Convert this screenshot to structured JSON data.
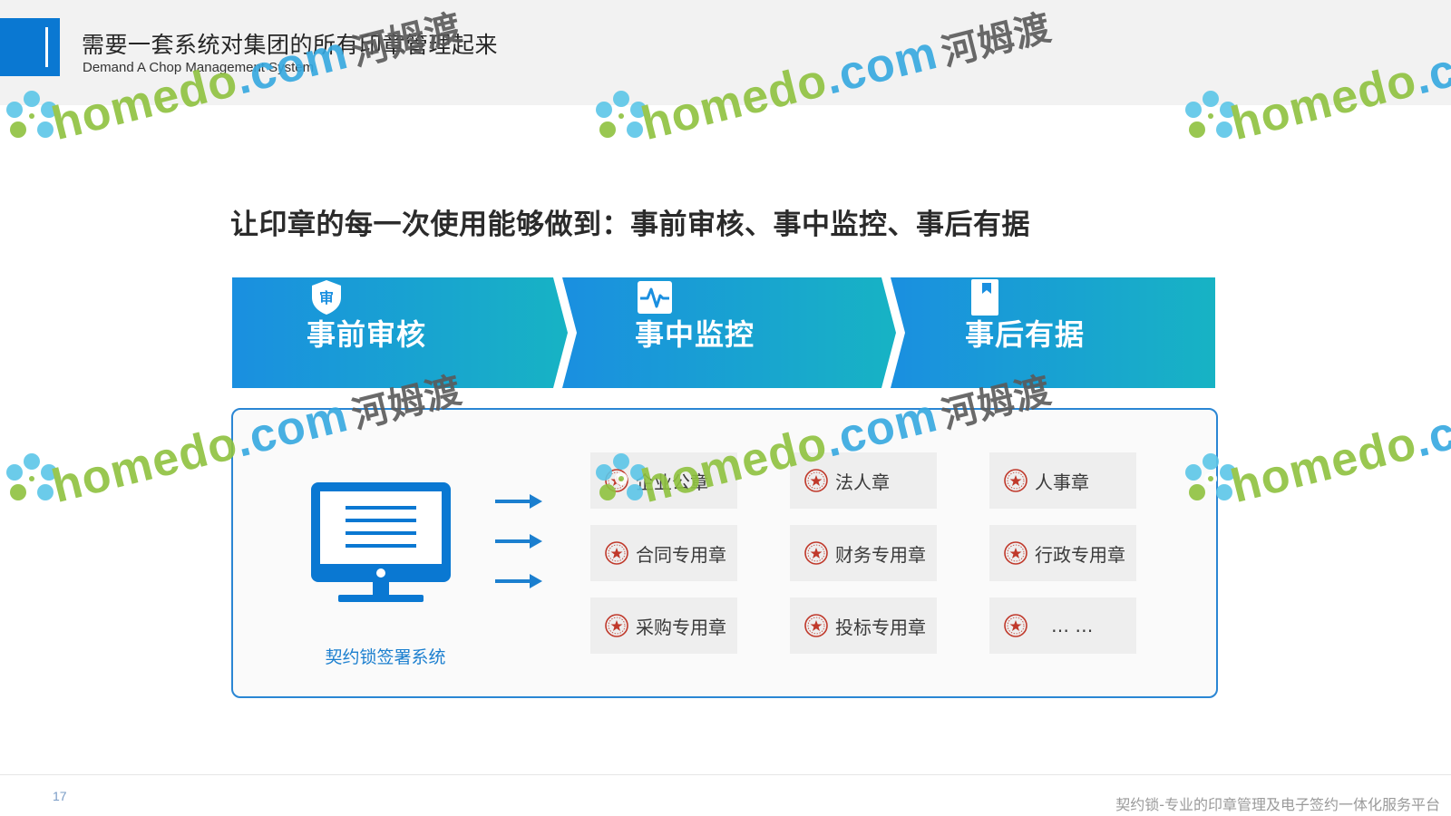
{
  "header": {
    "title": "需要一套系统对集团的所有印章管理起来",
    "subtitle": "Demand A Chop Management System"
  },
  "headline": "让印章的每一次使用能够做到：事前审核、事中监控、事后有据",
  "stages": [
    {
      "label": "事前审核",
      "icon": "shield-check-icon"
    },
    {
      "label": "事中监控",
      "icon": "pulse-monitor-icon"
    },
    {
      "label": "事后有据",
      "icon": "bookmark-icon"
    }
  ],
  "stage_icon_glyph": "审",
  "system": {
    "label": "契约锁签署系统",
    "icon": "computer-monitor-icon"
  },
  "seals": [
    "企业公章",
    "法人章",
    "人事章",
    "合同专用章",
    "财务专用章",
    "行政专用章",
    "采购专用章",
    "投标专用章",
    "… …"
  ],
  "footer": {
    "page_number": "17",
    "text": "契约锁-专业的印章管理及电子签约一体化服务平台"
  },
  "watermark": {
    "brand": "homedo",
    "domain": ".com",
    "cn": "河姆渡"
  },
  "colors": {
    "accent": "#0a78d2",
    "banner_start": "#1a8fe0",
    "banner_end": "#17b3c4",
    "box_border": "#2a86d4",
    "system_label": "#1b7fcf",
    "seal_red": "#c0392b"
  }
}
